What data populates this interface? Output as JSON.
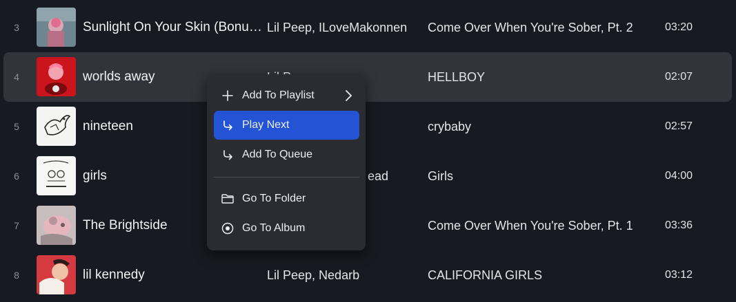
{
  "tracks": [
    {
      "number": "3",
      "title": "Sunlight On Your Skin (Bonus...",
      "artist": "Lil Peep, ILoveMakonnen",
      "album": "Come Over When You're Sober, Pt. 2",
      "duration": "03:20"
    },
    {
      "number": "4",
      "title": "worlds away",
      "artist": "Lil Peep",
      "album": "HELLBOY",
      "duration": "02:07"
    },
    {
      "number": "5",
      "title": "nineteen",
      "artist": "",
      "album": "crybaby",
      "duration": "02:57"
    },
    {
      "number": "6",
      "title": "girls",
      "artist": "ead",
      "album": "Girls",
      "duration": "04:00"
    },
    {
      "number": "7",
      "title": "The Brightside",
      "artist": "",
      "album": "Come Over When You're Sober, Pt. 1",
      "duration": "03:36"
    },
    {
      "number": "8",
      "title": "lil kennedy",
      "artist": "Lil Peep, Nedarb",
      "album": "CALIFORNIA GIRLS",
      "duration": "03:12"
    }
  ],
  "context_menu": {
    "items": [
      {
        "label": "Add To Playlist",
        "icon": "plus-icon",
        "submenu": true
      },
      {
        "label": "Play Next",
        "icon": "play-next-icon",
        "active": true
      },
      {
        "label": "Add To Queue",
        "icon": "add-to-queue-icon"
      },
      {
        "label": "Go To Folder",
        "icon": "folder-icon"
      },
      {
        "label": "Go To Album",
        "icon": "album-icon"
      }
    ]
  },
  "colors": {
    "background": "#171a22",
    "row_hover": "#32343b",
    "menu_background": "#2b2c31",
    "menu_active": "#2453d6"
  }
}
